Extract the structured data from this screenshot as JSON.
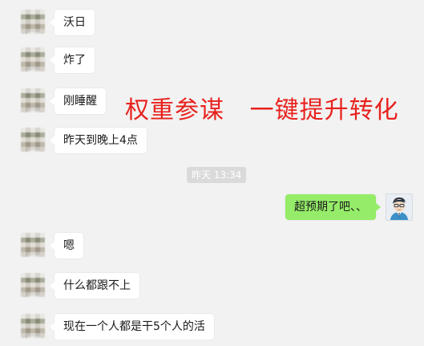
{
  "messages": [
    {
      "text": "沃日",
      "direction": "in"
    },
    {
      "text": "炸了",
      "direction": "in"
    },
    {
      "text": "刚睡醒",
      "direction": "in"
    },
    {
      "text": "昨天到晚上4点",
      "direction": "in"
    },
    {
      "text": "超预期了吧、、",
      "direction": "out"
    },
    {
      "text": "嗯",
      "direction": "in"
    },
    {
      "text": "什么都跟不上",
      "direction": "in"
    },
    {
      "text": "现在一个人都是干5个人的活",
      "direction": "in"
    }
  ],
  "timestamp": "昨天 13:34",
  "overlay": {
    "text": "权重参谋   一键提升转化",
    "color": "#e8221e"
  },
  "colors": {
    "background": "#f2f2f2",
    "incoming_bubble": "#ffffff",
    "outgoing_bubble": "#95ec69",
    "timestamp_bg": "#dadada"
  },
  "icons": {
    "self_avatar": "cartoon-man-avatar-icon",
    "contact_avatar": "blurred-contact-avatar"
  }
}
